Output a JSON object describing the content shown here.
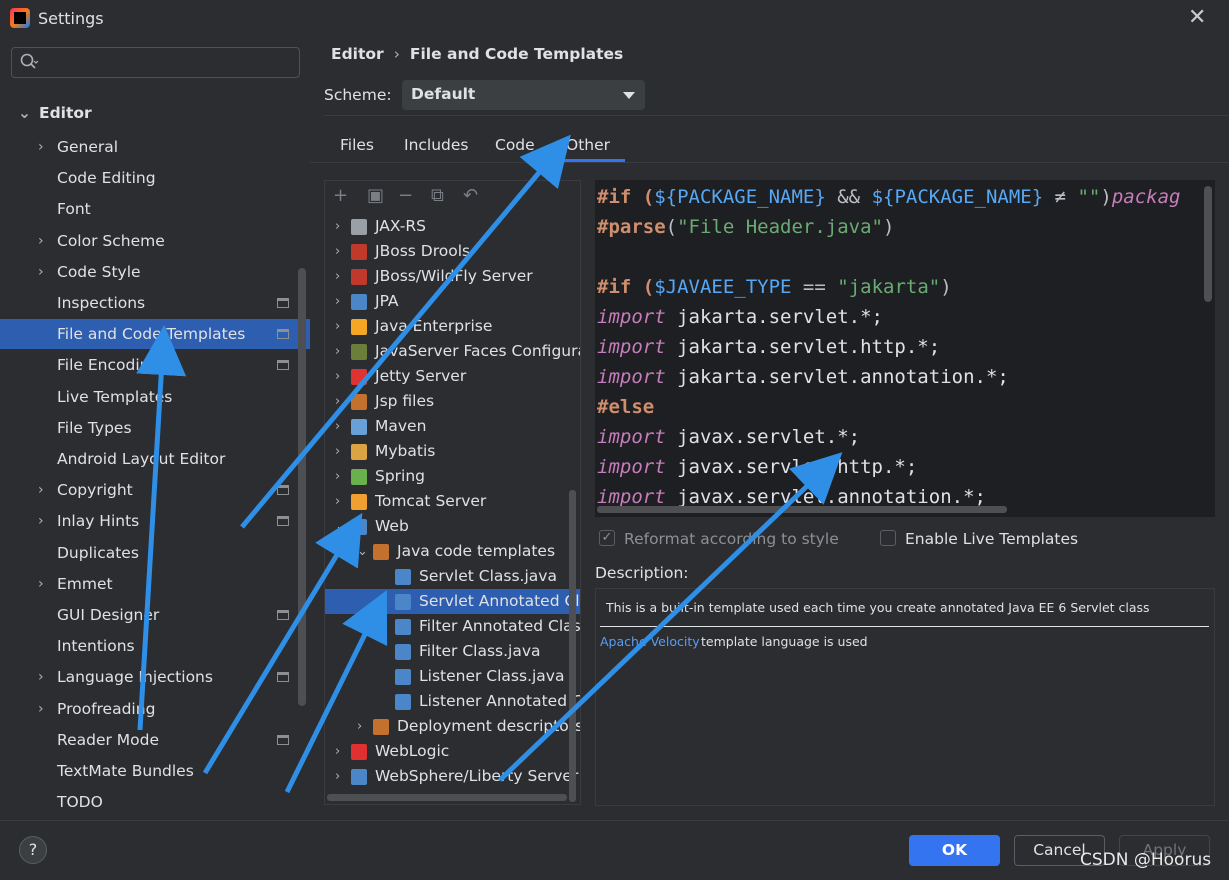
{
  "window": {
    "title": "Settings"
  },
  "sidebar": {
    "search_placeholder": "",
    "group_label": "Editor",
    "items": [
      {
        "label": "General",
        "chevron": true,
        "mark": false
      },
      {
        "label": "Code Editing",
        "chevron": false,
        "mark": false
      },
      {
        "label": "Font",
        "chevron": false,
        "mark": false
      },
      {
        "label": "Color Scheme",
        "chevron": true,
        "mark": false
      },
      {
        "label": "Code Style",
        "chevron": true,
        "mark": false
      },
      {
        "label": "Inspections",
        "chevron": false,
        "mark": true
      },
      {
        "label": "File and Code Templates",
        "chevron": false,
        "mark": true,
        "selected": true
      },
      {
        "label": "File Encodings",
        "chevron": false,
        "mark": true
      },
      {
        "label": "Live Templates",
        "chevron": false,
        "mark": false
      },
      {
        "label": "File Types",
        "chevron": false,
        "mark": false
      },
      {
        "label": "Android Layout Editor",
        "chevron": false,
        "mark": false
      },
      {
        "label": "Copyright",
        "chevron": true,
        "mark": true
      },
      {
        "label": "Inlay Hints",
        "chevron": true,
        "mark": true
      },
      {
        "label": "Duplicates",
        "chevron": false,
        "mark": false
      },
      {
        "label": "Emmet",
        "chevron": true,
        "mark": false
      },
      {
        "label": "GUI Designer",
        "chevron": false,
        "mark": true
      },
      {
        "label": "Intentions",
        "chevron": false,
        "mark": false
      },
      {
        "label": "Language Injections",
        "chevron": true,
        "mark": true
      },
      {
        "label": "Proofreading",
        "chevron": true,
        "mark": false
      },
      {
        "label": "Reader Mode",
        "chevron": false,
        "mark": true
      },
      {
        "label": "TextMate Bundles",
        "chevron": false,
        "mark": false
      },
      {
        "label": "TODO",
        "chevron": false,
        "mark": false
      }
    ]
  },
  "breadcrumb": {
    "parent": "Editor",
    "current": "File and Code Templates"
  },
  "scheme": {
    "label": "Scheme:",
    "value": "Default"
  },
  "tabs": [
    "Files",
    "Includes",
    "Code",
    "Other"
  ],
  "active_tab": "Other",
  "tree": [
    {
      "label": "JAX-RS",
      "icon_color": "#9aa0a6"
    },
    {
      "label": "JBoss Drools",
      "icon_color": "#c0392b"
    },
    {
      "label": "JBoss/WildFly Server",
      "icon_color": "#c0392b"
    },
    {
      "label": "JPA",
      "icon_color": "#4a86c8"
    },
    {
      "label": "Java Enterprise",
      "icon_color": "#f5a623"
    },
    {
      "label": "JavaServer Faces Configurati",
      "icon_color": "#6b7f3a"
    },
    {
      "label": "Jetty Server",
      "icon_color": "#d33"
    },
    {
      "label": "Jsp files",
      "icon_color": "#c4712e"
    },
    {
      "label": "Maven",
      "icon_color": "#6aa0d8"
    },
    {
      "label": "Mybatis",
      "icon_color": "#d9a441"
    },
    {
      "label": "Spring",
      "icon_color": "#6ab04c"
    },
    {
      "label": "Tomcat Server",
      "icon_color": "#f0a030"
    },
    {
      "label": "Web",
      "icon_color": "#4a86c8"
    },
    {
      "label": "Java code templates",
      "icon_color": "#c4712e"
    },
    {
      "label": "Servlet Class.java",
      "icon_color": "#4a86c8"
    },
    {
      "label": "Servlet Annotated Cla",
      "icon_color": "#4a86c8",
      "selected": true
    },
    {
      "label": "Filter Annotated Class.",
      "icon_color": "#4a86c8"
    },
    {
      "label": "Filter Class.java",
      "icon_color": "#4a86c8"
    },
    {
      "label": "Listener Class.java",
      "icon_color": "#4a86c8"
    },
    {
      "label": "Listener Annotated Cl",
      "icon_color": "#4a86c8"
    },
    {
      "label": "Deployment descriptors",
      "icon_color": "#c4712e"
    },
    {
      "label": "WebLogic",
      "icon_color": "#e03030"
    },
    {
      "label": "WebSphere/Liberty Server",
      "icon_color": "#4a86c8"
    }
  ],
  "code": {
    "l1": [
      "#if (",
      "${PACKAGE_NAME}",
      " && ",
      "${PACKAGE_NAME}",
      " ≠ ",
      "\"\"",
      ")",
      "packag"
    ],
    "l2": [
      "#parse",
      "(",
      "\"File Header.java\"",
      ")"
    ],
    "l3": [
      "#if (",
      "$JAVAEE_TYPE",
      " == ",
      "\"jakarta\"",
      ")"
    ],
    "import_kw": "import",
    "else_kw": "#else",
    "imports_jakarta": [
      "jakarta.servlet.*;",
      "jakarta.servlet.http.*;",
      "jakarta.servlet.annotation.*;"
    ],
    "imports_javax": [
      "javax.servlet.*;",
      "javax.servlet.http.*;",
      "javax.servlet.annotation.*;"
    ]
  },
  "options": {
    "reformat_label": "Reformat according to style",
    "reformat_checked": true,
    "live_templates_label": "Enable Live Templates",
    "live_templates_checked": false
  },
  "description": {
    "title": "Description:",
    "text": "This is a built-in template used each time you create annotated Java EE 6 Servlet class",
    "link": "Apache Velocity",
    "link_suffix": " template language is used"
  },
  "buttons": {
    "help": "?",
    "ok": "OK",
    "cancel": "Cancel",
    "apply": "Apply"
  },
  "watermark": "CSDN @Hoorus",
  "colors": {
    "accent": "#3574f0",
    "selection": "#2e5eb0",
    "arrow": "#2f8fe6"
  }
}
